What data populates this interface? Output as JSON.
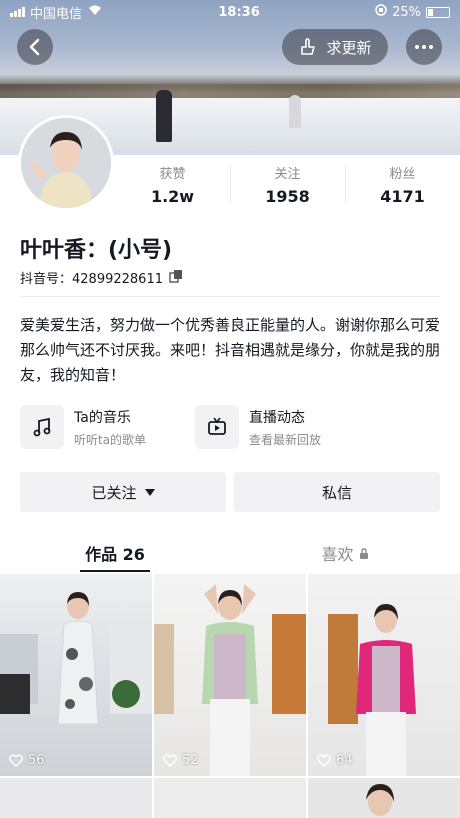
{
  "status_bar": {
    "carrier": "中国电信",
    "time": "18:36",
    "battery": "25%"
  },
  "header": {
    "update_label": "求更新"
  },
  "stats": [
    {
      "label": "获赞",
      "value": "1.2w"
    },
    {
      "label": "关注",
      "value": "1958"
    },
    {
      "label": "粉丝",
      "value": "4171"
    }
  ],
  "profile": {
    "name": "叶叶香：(小号)",
    "douyin_id": "抖音号：42899228611",
    "bio": "爱美爱生活，努力做一个优秀善良正能量的人。谢谢你那么可爱那么帅气还不讨厌我。来吧！抖音相遇就是缘分，你就是我的朋友，我的知音！"
  },
  "shortcuts": [
    {
      "title": "Ta的音乐",
      "subtitle": "听听ta的歌单",
      "icon": "music-note-icon"
    },
    {
      "title": "直播动态",
      "subtitle": "查看最新回放",
      "icon": "live-tv-icon"
    }
  ],
  "actions": {
    "follow_label": "已关注",
    "message_label": "私信"
  },
  "tabs": [
    {
      "label": "作品 26",
      "active": true
    },
    {
      "label": "喜欢",
      "active": false,
      "locked": true
    }
  ],
  "videos": [
    {
      "likes": "56"
    },
    {
      "likes": "52"
    },
    {
      "likes": "64"
    }
  ]
}
